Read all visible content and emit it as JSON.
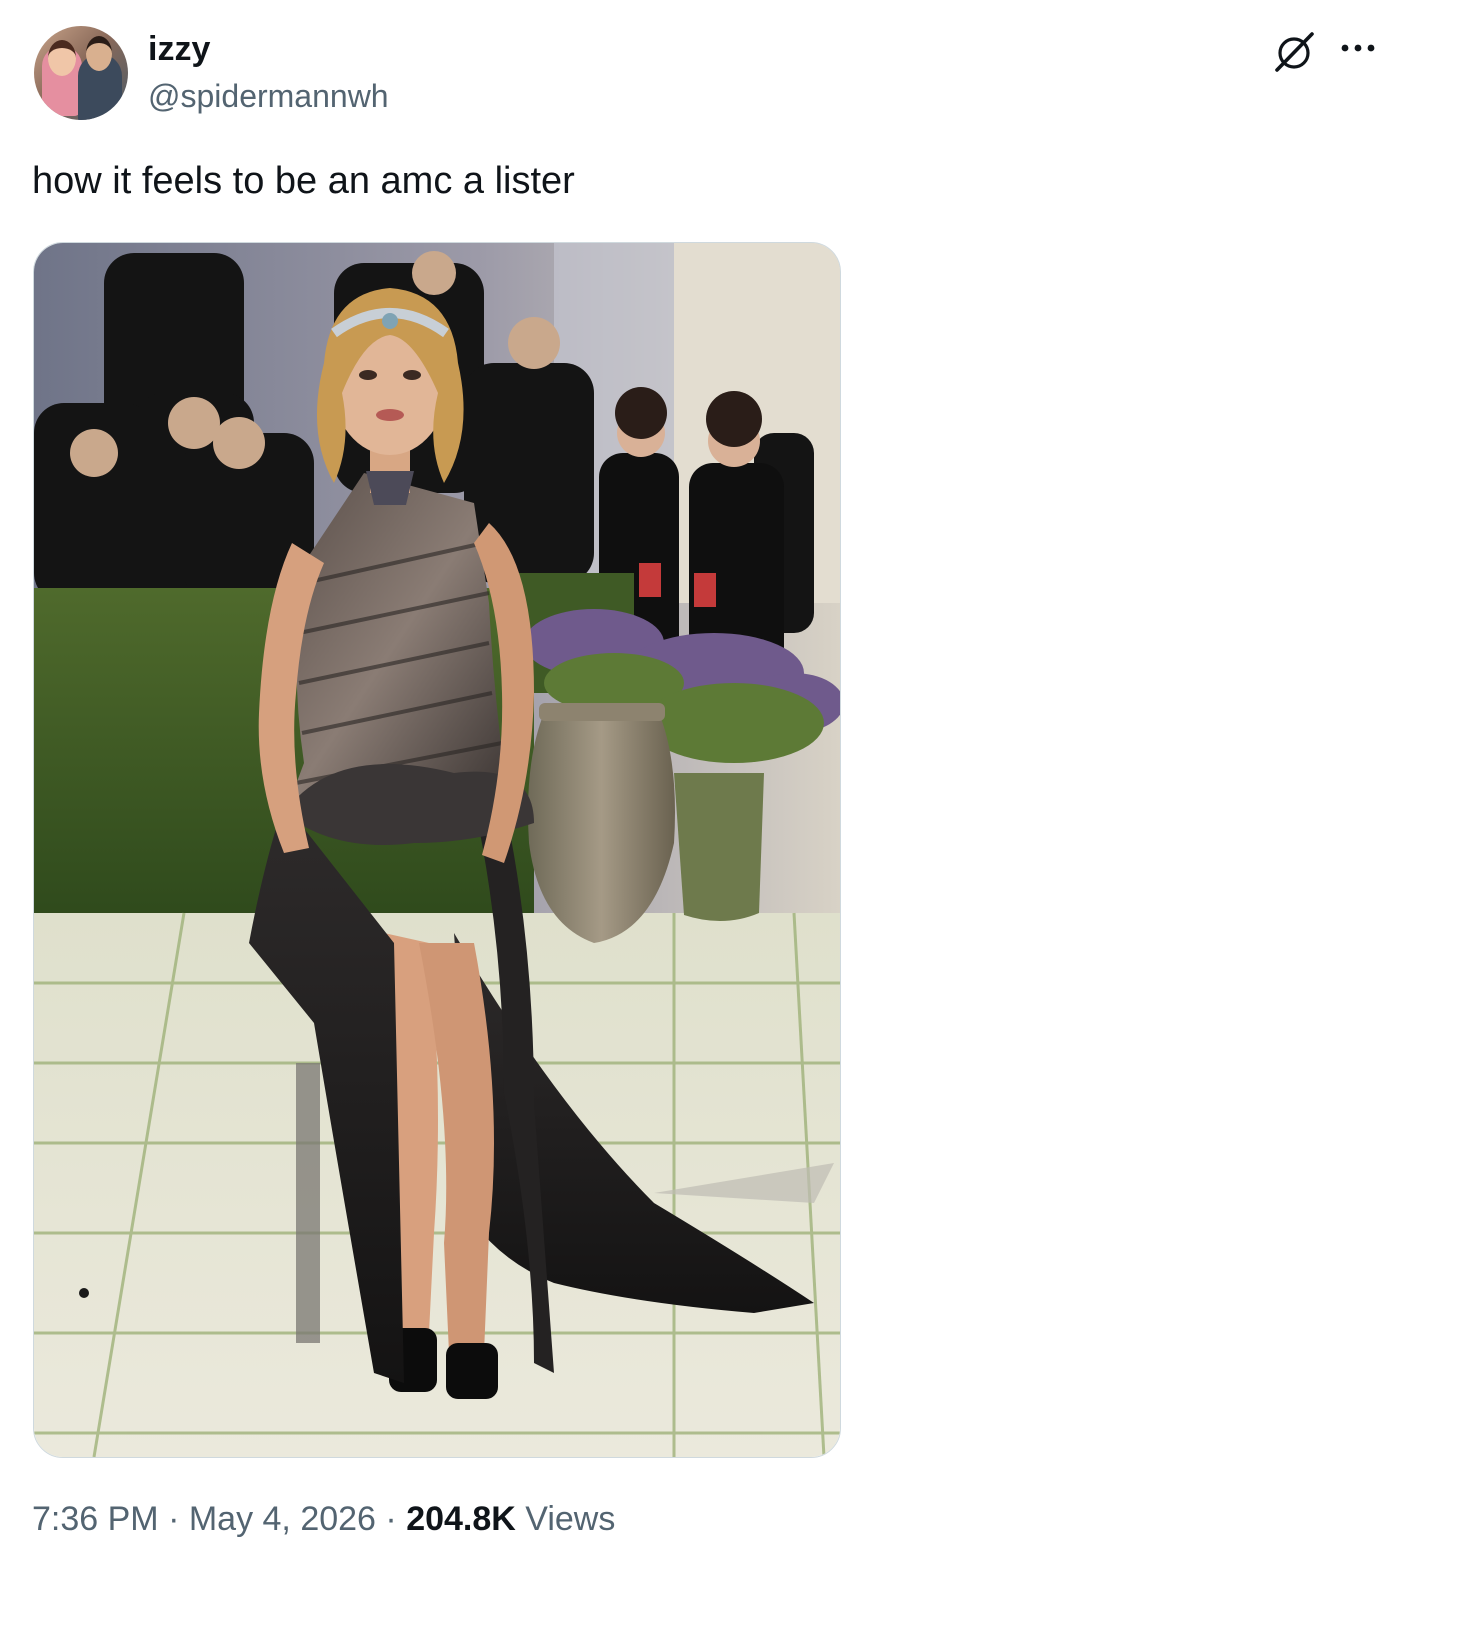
{
  "tweet": {
    "author_name": "izzy",
    "author_handle": "@spidermannwh",
    "text": "how it feels to be an amc a lister",
    "time": "7:36 PM",
    "date": "May 4, 2026",
    "separator": " · ",
    "views_count": "204.8K",
    "views_label": " Views"
  },
  "icons": {
    "grok": "grok-icon",
    "more": "more-icon"
  },
  "colors": {
    "text_primary": "#0f1419",
    "text_secondary": "#536471",
    "border": "#cfd9de"
  }
}
